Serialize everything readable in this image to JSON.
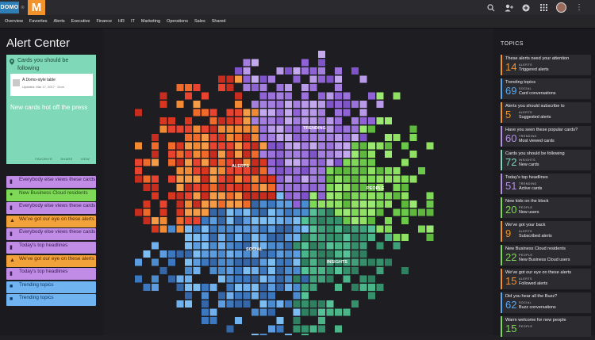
{
  "brand": {
    "logo_text": "DOMO",
    "separator": "⊗",
    "app_logo": "M"
  },
  "topbar_icons": [
    "search-icon",
    "add-user-icon",
    "plus-icon",
    "grid-icon",
    "avatar"
  ],
  "nav": [
    "Overview",
    "Favorites",
    "Alerts",
    "Executive",
    "Finance",
    "HR",
    "IT",
    "Marketing",
    "Operations",
    "Sales",
    "Shared"
  ],
  "left": {
    "title": "Alert Center",
    "feature_card": {
      "icon": "pin-icon",
      "title": "Cards you should be following",
      "inner_title": "A Domo-style table",
      "inner_sub": "Updated: Mar 17, 2017 · Dom",
      "body": "New cards hot off the press",
      "actions": [
        "FAVORITE",
        "SHARE",
        "VIEW"
      ]
    },
    "cards": [
      {
        "label": "Everybody else views these cards",
        "color": "purple",
        "icon": "bar-chart-icon"
      },
      {
        "label": "New Business Cloud residents",
        "color": "green",
        "icon": "people-icon"
      },
      {
        "label": "Everybody else views these cards",
        "color": "purple",
        "icon": "bar-chart-icon"
      },
      {
        "label": "We've got our eye on these alerts",
        "color": "orange",
        "icon": "bell-icon"
      },
      {
        "label": "Everybody else views these cards",
        "color": "purple",
        "icon": "bar-chart-icon"
      },
      {
        "label": "Today's top headlines",
        "color": "purple",
        "icon": "bar-chart-icon"
      },
      {
        "label": "We've got our eye on these alerts",
        "color": "orange",
        "icon": "bell-icon"
      },
      {
        "label": "Today's top headlines",
        "color": "purple",
        "icon": "bar-chart-icon"
      },
      {
        "label": "Trending topics",
        "color": "blue",
        "icon": "chat-icon"
      },
      {
        "label": "Trending topics",
        "color": "blue",
        "icon": "chat-icon"
      }
    ]
  },
  "cluster_labels": [
    "TRENDING",
    "ALERTS",
    "PEOPLE",
    "SOCIAL",
    "INSIGHTS"
  ],
  "cluster_colors": {
    "trending": [
      "#b99ae8",
      "#a57fe0",
      "#8f63d6",
      "#c4a9ee",
      "#9b72dc",
      "#7f54c9"
    ],
    "alerts": [
      "#e8432f",
      "#f06a2a",
      "#f28a34",
      "#d9361f",
      "#f59a45",
      "#c72d1e"
    ],
    "people": [
      "#7ed957",
      "#6cc84a",
      "#8fe063",
      "#5db83d",
      "#9be872"
    ],
    "social": [
      "#5b9de0",
      "#4b8bd0",
      "#6fb0ee",
      "#3c78bf",
      "#7cbdf2",
      "#3566a8"
    ],
    "insights": [
      "#3fa07a",
      "#4bb58a",
      "#35916c",
      "#56c297",
      "#2f8060"
    ]
  },
  "right": {
    "title": "TOPICS",
    "topics": [
      {
        "title": "These alerts need your attention",
        "number": "14",
        "category": "ALERTS",
        "sub": "Triggered alerts",
        "color": "#f2932b"
      },
      {
        "title": "Trending topics",
        "number": "69",
        "category": "SOCIAL",
        "sub": "Card conversations",
        "color": "#5ba8ef"
      },
      {
        "title": "Alerts you should subscribe to",
        "number": "5",
        "category": "ALERTS",
        "sub": "Suggested alerts",
        "color": "#f2932b"
      },
      {
        "title": "Have you seen these popular cards?",
        "number": "60",
        "category": "TRENDING",
        "sub": "Most viewed cards",
        "color": "#b68fe6"
      },
      {
        "title": "Cards you should be following",
        "number": "72",
        "category": "INSIGHTS",
        "sub": "New cards",
        "color": "#7fd8b7"
      },
      {
        "title": "Today's top headlines",
        "number": "51",
        "category": "TRENDING",
        "sub": "Active cards",
        "color": "#b68fe6"
      },
      {
        "title": "New kids on the block",
        "number": "20",
        "category": "PEOPLE",
        "sub": "New users",
        "color": "#7ed957"
      },
      {
        "title": "We've got your back",
        "number": "9",
        "category": "ALERTS",
        "sub": "Subscribed alerts",
        "color": "#f2932b"
      },
      {
        "title": "New Business Cloud residents",
        "number": "22",
        "category": "PEOPLE",
        "sub": "New Business Cloud users",
        "color": "#7ed957"
      },
      {
        "title": "We've got our eye on these alerts",
        "number": "15",
        "category": "ALERTS",
        "sub": "Followed alerts",
        "color": "#f2932b"
      },
      {
        "title": "Did you hear all the Buzz?",
        "number": "62",
        "category": "SOCIAL",
        "sub": "Buzz conversations",
        "color": "#5ba8ef"
      },
      {
        "title": "Warm welcome for new people",
        "number": "15",
        "category": "PEOPLE",
        "sub": "",
        "color": "#7ed957"
      }
    ]
  }
}
